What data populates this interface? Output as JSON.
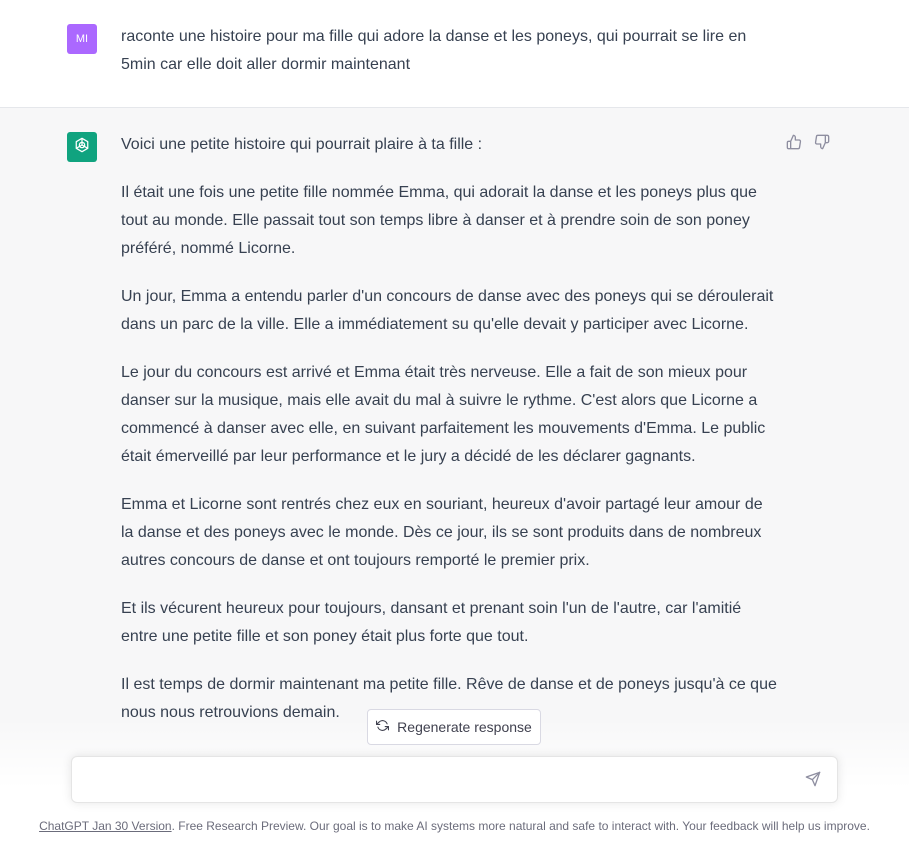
{
  "user": {
    "avatar_initials": "MI",
    "avatar_color": "#ab68ff",
    "message": "raconte une histoire pour ma fille qui adore la danse et les poneys, qui pourrait se lire en 5min car elle doit aller dormir maintenant"
  },
  "assistant": {
    "avatar_color": "#10a37f",
    "avatar_icon": "openai-logo-icon",
    "paragraphs": [
      "Voici une petite histoire qui pourrait plaire à ta fille :",
      "Il était une fois une petite fille nommée Emma, qui adorait la danse et les poneys plus que tout au monde. Elle passait tout son temps libre à danser et à prendre soin de son poney préféré, nommé Licorne.",
      "Un jour, Emma a entendu parler d'un concours de danse avec des poneys qui se déroulerait dans un parc de la ville. Elle a immédiatement su qu'elle devait y participer avec Licorne.",
      "Le jour du concours est arrivé et Emma était très nerveuse. Elle a fait de son mieux pour danser sur la musique, mais elle avait du mal à suivre le rythme. C'est alors que Licorne a commencé à danser avec elle, en suivant parfaitement les mouvements d'Emma. Le public était émerveillé par leur performance et le jury a décidé de les déclarer gagnants.",
      "Emma et Licorne sont rentrés chez eux en souriant, heureux d'avoir partagé leur amour de la danse et des poneys avec le monde. Dès ce jour, ils se sont produits dans de nombreux autres concours de danse et ont toujours remporté le premier prix.",
      "Et ils vécurent heureux pour toujours, dansant et prenant soin l'un de l'autre, car l'amitié entre une petite fille et son poney était plus forte que tout.",
      "Il est temps de dormir maintenant ma petite fille. Rêve de danse et de poneys jusqu'à ce que nous nous retrouvions demain."
    ],
    "thumbs_up_icon": "thumbs-up-icon",
    "thumbs_down_icon": "thumbs-down-icon"
  },
  "regenerate": {
    "label": "Regenerate response",
    "icon": "refresh-icon"
  },
  "input": {
    "value": "",
    "placeholder": "",
    "send_icon": "send-icon"
  },
  "footer": {
    "link_text": "ChatGPT Jan 30 Version",
    "text": ". Free Research Preview. Our goal is to make AI systems more natural and safe to interact with. Your feedback will help us improve."
  }
}
